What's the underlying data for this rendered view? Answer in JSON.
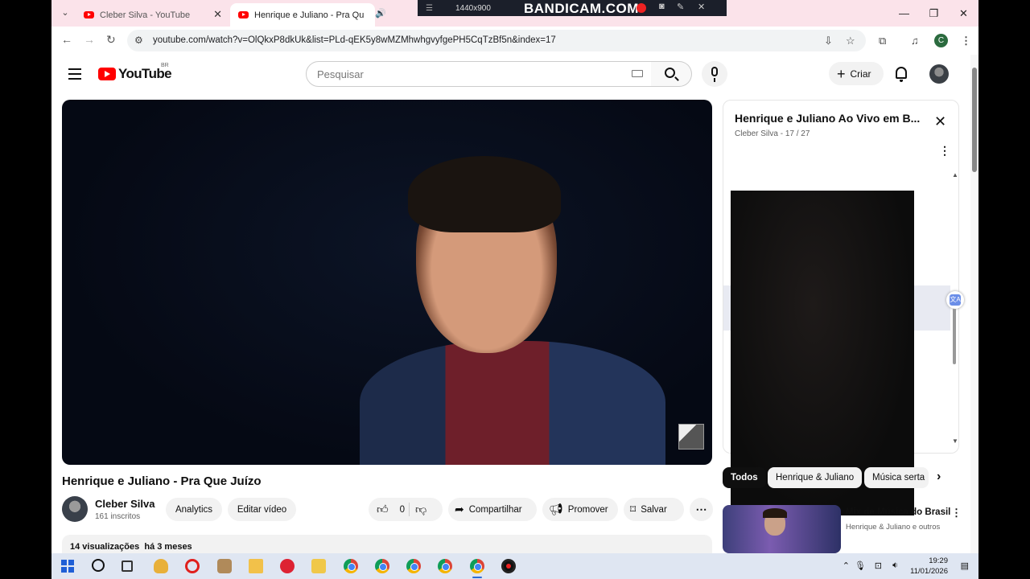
{
  "browser": {
    "tabs": [
      {
        "title": "Cleber Silva - YouTube",
        "active": false
      },
      {
        "title": "Henrique e Juliano - Pra Qu",
        "active": true
      }
    ],
    "url": "youtube.com/watch?v=OlQkxP8dkUk&list=PLd-qEK5y8wMZMhwhgvyfgePH5CqTzBf5n&index=17",
    "profile_initial": "C"
  },
  "recorder": {
    "resolution": "1440x900",
    "brand": "BANDICAM.COM"
  },
  "youtube": {
    "logo_text": "YouTube",
    "country_code": "BR",
    "search_placeholder": "Pesquisar",
    "create_label": "Criar",
    "video": {
      "title": "Henrique e Juliano - Pra Que Juízo",
      "channel": "Cleber Silva",
      "subscribers": "161 inscritos",
      "analytics_label": "Analytics",
      "edit_label": "Editar vídeo",
      "likes": "0",
      "share_label": "Compartilhar",
      "promote_label": "Promover",
      "save_label": "Salvar",
      "views": "14 visualizações",
      "age": "há 3 meses"
    },
    "playlist": {
      "title": "Henrique e Juliano Ao Vivo em B...",
      "owner": "Cleber Silva",
      "position": "17 / 27"
    },
    "chips": [
      "Todos",
      "Henrique & Juliano",
      "Música serta"
    ],
    "suggestion": {
      "title": "Mix de Música do Brasil",
      "subtitle": "Henrique & Juliano e outros"
    }
  },
  "taskbar": {
    "time": "19:29",
    "date": "11/01/2026"
  }
}
